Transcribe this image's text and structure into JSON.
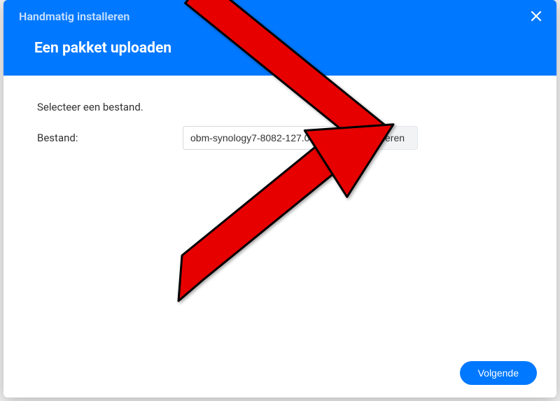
{
  "header": {
    "title": "Handmatig installeren",
    "subtitle": "Een pakket uploaden"
  },
  "body": {
    "instruction": "Selecteer een bestand.",
    "file_label": "Bestand:",
    "file_value": "obm-synology7-8082-127.0",
    "browse_label": "Bladeren"
  },
  "footer": {
    "next_label": "Volgende"
  }
}
